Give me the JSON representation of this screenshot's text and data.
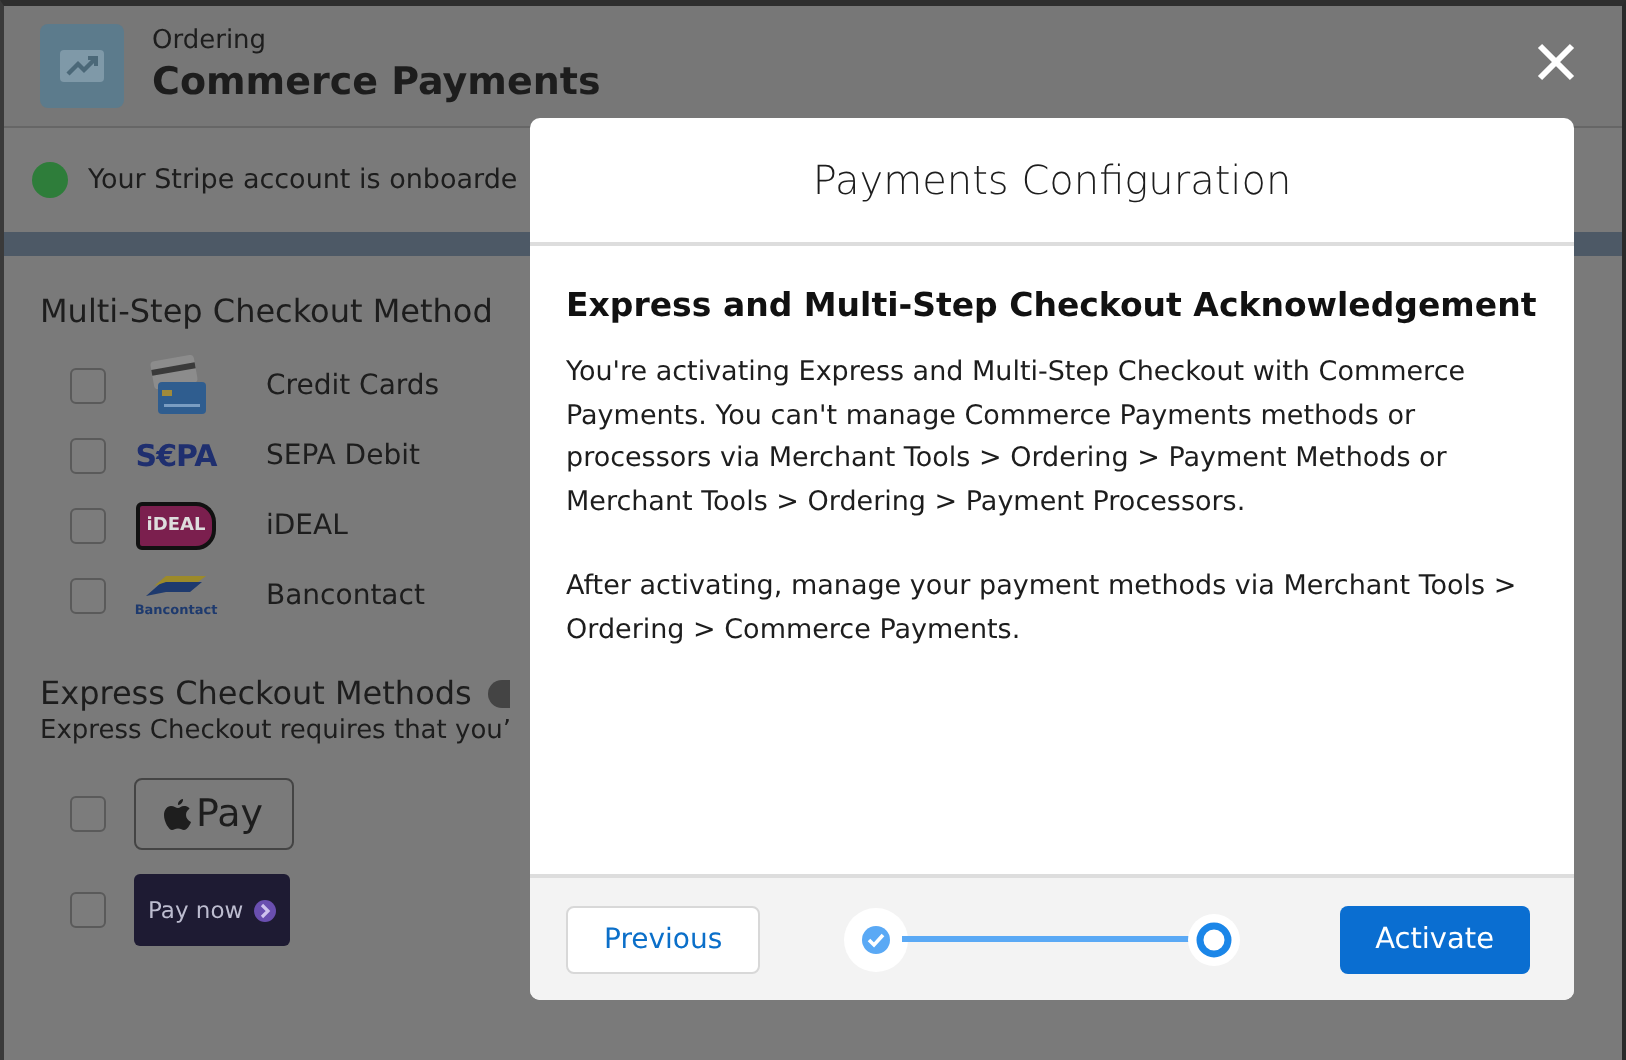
{
  "page_header": {
    "eyebrow": "Ordering",
    "title": "Commerce Payments"
  },
  "banner": {
    "text": "Your Stripe account is onboarde",
    "color": "#2e7d3a"
  },
  "multi_step": {
    "heading": "Multi-Step Checkout Method",
    "methods": [
      {
        "label": "Credit Cards",
        "checked": false,
        "kind": "card"
      },
      {
        "label": "SEPA Debit",
        "checked": false,
        "kind": "sepa",
        "logo_text": "S€PA"
      },
      {
        "label": "iDEAL",
        "checked": false,
        "kind": "ideal",
        "logo_text": "iDEAL"
      },
      {
        "label": "Bancontact",
        "checked": false,
        "kind": "bancontact",
        "logo_text": "Bancontact"
      }
    ]
  },
  "express": {
    "heading": "Express Checkout Methods",
    "note": "Express Checkout requires that you’",
    "methods": [
      {
        "checked": false,
        "kind": "applepay",
        "logo_text": "Pay"
      },
      {
        "checked": false,
        "kind": "paynow",
        "logo_text": "Pay now"
      }
    ]
  },
  "modal": {
    "title": "Payments Configuration",
    "heading": "Express and Multi-Step Checkout Acknowledgement",
    "paragraphs": [
      "You're activating Express and Multi-Step Checkout with Commerce Payments. You can't manage Commerce Payments methods or processors via Merchant Tools > Ordering > Payment Methods or Merchant Tools > Ordering > Payment Processors.",
      "After activating, manage your payment methods via Merchant Tools > Ordering > Commerce Payments."
    ],
    "previous": "Previous",
    "activate": "Activate",
    "steps": [
      {
        "kind": "complete"
      },
      {
        "kind": "current"
      }
    ]
  }
}
